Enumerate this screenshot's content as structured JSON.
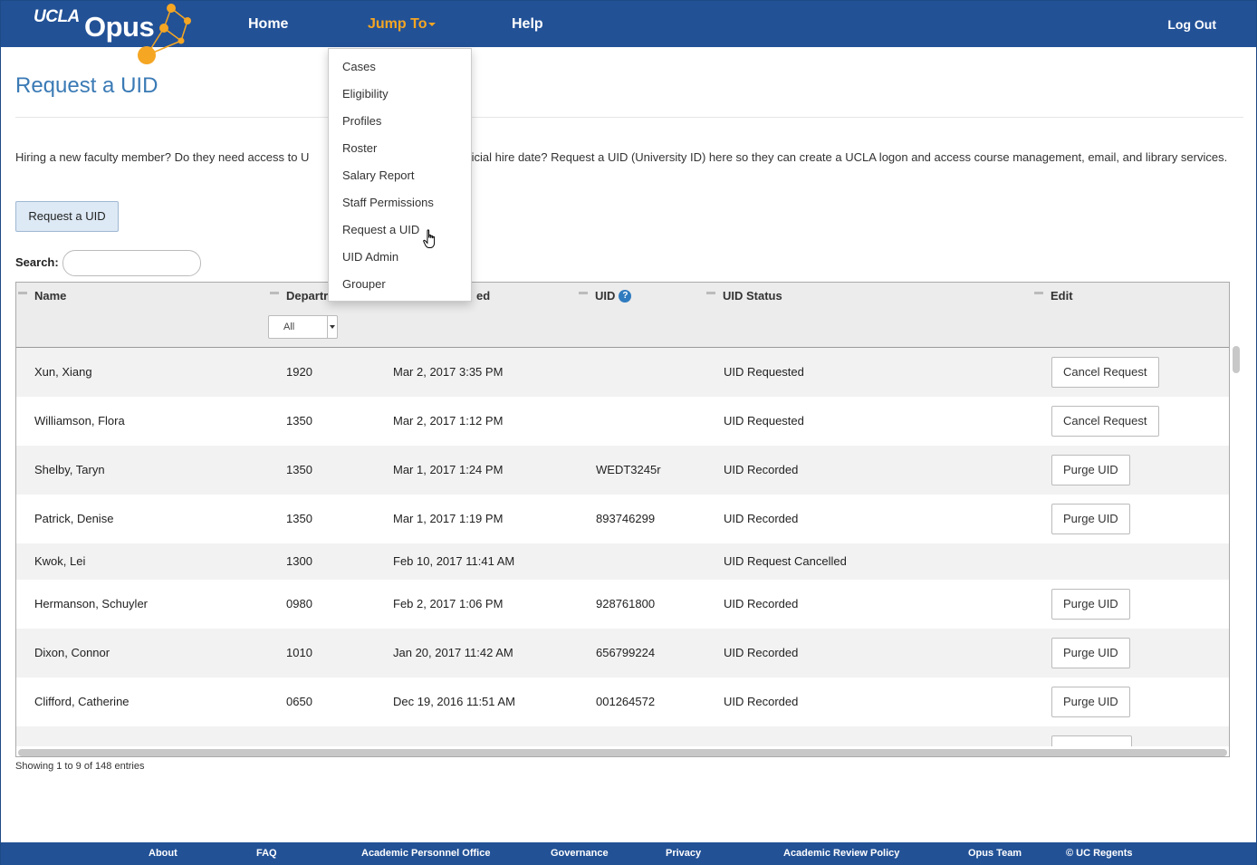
{
  "header": {
    "logo_ucla": "UCLA",
    "logo_opus": "Opus",
    "nav": {
      "home": "Home",
      "jump_to": "Jump To",
      "help": "Help"
    },
    "logout": "Log Out"
  },
  "jump_menu": {
    "items": [
      "Cases",
      "Eligibility",
      "Profiles",
      "Roster",
      "Salary Report",
      "Staff Permissions",
      "Request a UID",
      "UID Admin",
      "Grouper"
    ],
    "hovered": "Request a UID"
  },
  "page": {
    "title": "Request a UID",
    "intro_before": "Hiring a new faculty member? Do they need access to U",
    "intro_after": "official hire date? Request a UID (University ID) here so they can create a UCLA logon and access course management, email, and library services.",
    "request_button": "Request a UID",
    "search_label": "Search:"
  },
  "table": {
    "headers": {
      "name": "Name",
      "department": "Departr",
      "requested": "ed",
      "uid": "UID",
      "uid_status": "UID Status",
      "edit": "Edit"
    },
    "department_filter": "All",
    "rows": [
      {
        "name": "Xun, Xiang",
        "dept": "1920",
        "date": "Mar 2, 2017 3:35 PM",
        "uid": "",
        "status": "UID Requested",
        "action": "Cancel Request"
      },
      {
        "name": "Williamson, Flora",
        "dept": "1350",
        "date": "Mar 2, 2017 1:12 PM",
        "uid": "",
        "status": "UID Requested",
        "action": "Cancel Request"
      },
      {
        "name": "Shelby, Taryn",
        "dept": "1350",
        "date": "Mar 1, 2017 1:24 PM",
        "uid": "WEDT3245r",
        "status": "UID Recorded",
        "action": "Purge UID"
      },
      {
        "name": "Patrick, Denise",
        "dept": "1350",
        "date": "Mar 1, 2017 1:19 PM",
        "uid": "893746299",
        "status": "UID Recorded",
        "action": "Purge UID"
      },
      {
        "name": "Kwok, Lei",
        "dept": "1300",
        "date": "Feb 10, 2017 11:41 AM",
        "uid": "",
        "status": "UID Request Cancelled",
        "action": ""
      },
      {
        "name": "Hermanson, Schuyler",
        "dept": "0980",
        "date": "Feb 2, 2017 1:06 PM",
        "uid": "928761800",
        "status": "UID Recorded",
        "action": "Purge UID"
      },
      {
        "name": "Dixon, Connor",
        "dept": "1010",
        "date": "Jan 20, 2017 11:42 AM",
        "uid": "656799224",
        "status": "UID Recorded",
        "action": "Purge UID"
      },
      {
        "name": "Clifford, Catherine",
        "dept": "0650",
        "date": "Dec 19, 2016 11:51 AM",
        "uid": "001264572",
        "status": "UID Recorded",
        "action": "Purge UID"
      }
    ],
    "showing": "Showing 1 to 9 of 148 entries"
  },
  "footer": {
    "links": [
      "About",
      "FAQ",
      "Academic Personnel Office",
      "Governance",
      "Privacy",
      "Academic Review Policy",
      "Opus Team",
      "© UC Regents"
    ]
  },
  "colors": {
    "nav_bg": "#225196",
    "accent_orange": "#f5a623",
    "title_blue": "#3a7ab5"
  }
}
